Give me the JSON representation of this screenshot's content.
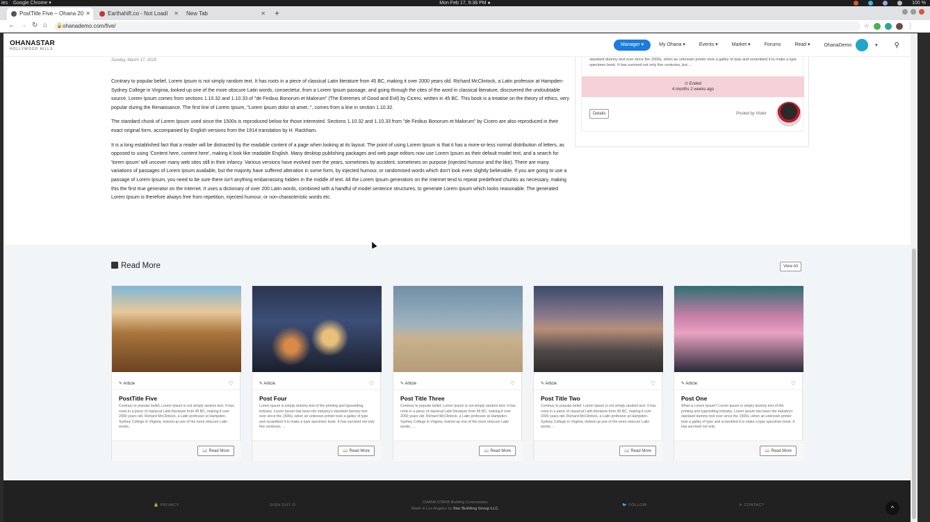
{
  "os": {
    "left_items": [
      "ies",
      "Google Chrome ▾"
    ],
    "clock": "Mon Feb 17,  9:38 PM ●",
    "battery": "100 %"
  },
  "browser": {
    "tabs": [
      {
        "label": "PostTitle Five – Ohana 20",
        "active": true
      },
      {
        "label": "Earthahift.co - Not Loadi",
        "active": false
      },
      {
        "label": "New Tab",
        "active": false
      }
    ],
    "url": "ohanademo.com/five/"
  },
  "site": {
    "logo_main": "OHANASTAR",
    "logo_sub": "HOLLYWOOD HILLS",
    "nav": {
      "manager": "Manager ▾",
      "my_ohana": "My Ohana ▾",
      "events": "Events ▾",
      "market": "Market ▾",
      "forums": "Forums",
      "read": "Read ▾",
      "user": "OhanaDemo",
      "user_caret": "▾"
    }
  },
  "article": {
    "date": "Sunday, March 17, 2019",
    "p1": "Contrary to popular belief, Lorem Ipsum is not simply random text. It has roots in a piece of classical Latin literature from 45 BC, making it over 2000 years old. Richard McClintock, a Latin professor at Hampden-Sydney College in Virginia, looked up one of the more obscure Latin words, consectetur, from a Lorem Ipsum passage, and going through the cites of the word in classical literature, discovered the undoubtable source. Lorem Ipsum comes from sections 1.10.32 and 1.10.33 of \"de Finibus Bonorum et Malorum\" (The Extremes of Good and Evil) by Cicero, written in 45 BC. This book is a treatise on the theory of ethics, very popular during the Renaissance. The first line of Lorem Ipsum, \"Lorem ipsum dolor sit amet..\", comes from a line in section 1.10.32.",
    "p2": "The standard chunk of Lorem Ipsum used since the 1500s is reproduced below for those interested. Sections 1.10.32 and 1.10.33 from \"de Finibus Bonorum et Malorum\" by Cicero are also reproduced in their exact original form, accompanied by English versions from the 1914 translation by H. Rackham.",
    "p3": "It is a long established fact that a reader will be distracted by the readable content of a page when looking at its layout. The point of using Lorem Ipsum is that it has a more-or-less normal distribution of letters, as opposed to using 'Content here, content here', making it look like readable English. Many desktop publishing packages and web page editors now use Lorem Ipsum as their default model text, and a search for 'lorem ipsum' will uncover many web sites still in their infancy. Various versions have evolved over the years, sometimes by accident, sometimes on purpose (injected humour and the like). There are many variations of passages of Lorem Ipsum available, but the majority have suffered alteration in some form, by injected humour, or randomised words which don't look even slightly believable. If you are going to use a passage of Lorem Ipsum, you need to be sure there isn't anything embarrassing hidden in the middle of text. All the Lorem Ipsum generators on the Internet tend to repeat predefined chunks as necessary, making this the first true generator on the Internet. It uses a dictionary of over 200 Latin words, combined with a handful of model sentence structures, to generate Lorem Ipsum which looks reasonable. The generated Lorem Ipsum is therefore always free from repetition, injected humour, or non-characteristic words etc."
  },
  "event_card": {
    "text": "standard dummy text ever since the 1500s, when an unknown printer took a galley of type and scrambled it to make a type specimen book. It has survived not only five centuries, but ...",
    "status": "⊙ Ended",
    "when": "4 months 2 weeks ago",
    "details_label": "Details",
    "posted_by": "Posted by Violet"
  },
  "read_more": {
    "title": "Read More",
    "view_all": "View All",
    "cards": [
      {
        "type": "Article",
        "title": "PostTitle Five",
        "desc": "Contrary to popular belief, Lorem Ipsum is not simply random text. It has roots in a piece of classical Latin literature from 45 BC, making it over 2000 years old. Richard McClintock, a Latin professor at Hampden-Sydney College in Virginia, looked up one of the more obscure Latin words,",
        "button": "Read More"
      },
      {
        "type": "Article",
        "title": "Post Four",
        "desc": "Lorem Ipsum is simply dummy text of the printing and typesetting industry. Lorem Ipsum has been the industry's standard dummy text ever since the 1500s, when an unknown printer took a galley of type and scrambled it to make a type specimen book. It has survived not only five centuries, ...",
        "button": "Read More"
      },
      {
        "type": "Article",
        "title": "Post Title Three",
        "desc": "Contrary to popular belief, Lorem Ipsum is not simply random text. It has roots in a piece of classical Latin literature from 45 BC, making it over 2000 years old. Richard McClintock, a Latin professor at Hampden-Sydney College in Virginia, looked up one of the more obscure Latin words, ...",
        "button": "Read More"
      },
      {
        "type": "Article",
        "title": "Post Title Two",
        "desc": "Contrary to popular belief, Lorem Ipsum is not simply random text. It has roots in a piece of classical Latin literature from 45 BC, making it over 2000 years old. Richard McClintock, a Latin professor at Hampden-Sydney College in Virginia, looked up one of the more obscure Latin words, ...",
        "button": "Read More"
      },
      {
        "type": "Article",
        "title": "Post One",
        "desc": "What is Lorem Ipsum? Lorem Ipsum is simply dummy text of the printing and typesetting industry. Lorem Ipsum has been the industry's standard dummy text ever since the 1500s, when an unknown printer took a galley of type and scrambled it to make a type specimen book. It has survived not only",
        "button": "Read More"
      }
    ]
  },
  "footer": {
    "privacy": "🔒 PRIVACY",
    "signout": "SIGN OUT ⏻",
    "brand_line": "OHANA STAR® Building Communities",
    "made_in": "Made in Los Angeles by",
    "company": "Star Building Group LLC.",
    "follow": "🐦 FOLLOW",
    "contact": "✈ CONTACT"
  },
  "colors": {
    "accent": "#1a7be0",
    "ended_bg": "#f5d1d8",
    "footer_bg": "#212121",
    "section_bg": "#f2f5f7"
  }
}
